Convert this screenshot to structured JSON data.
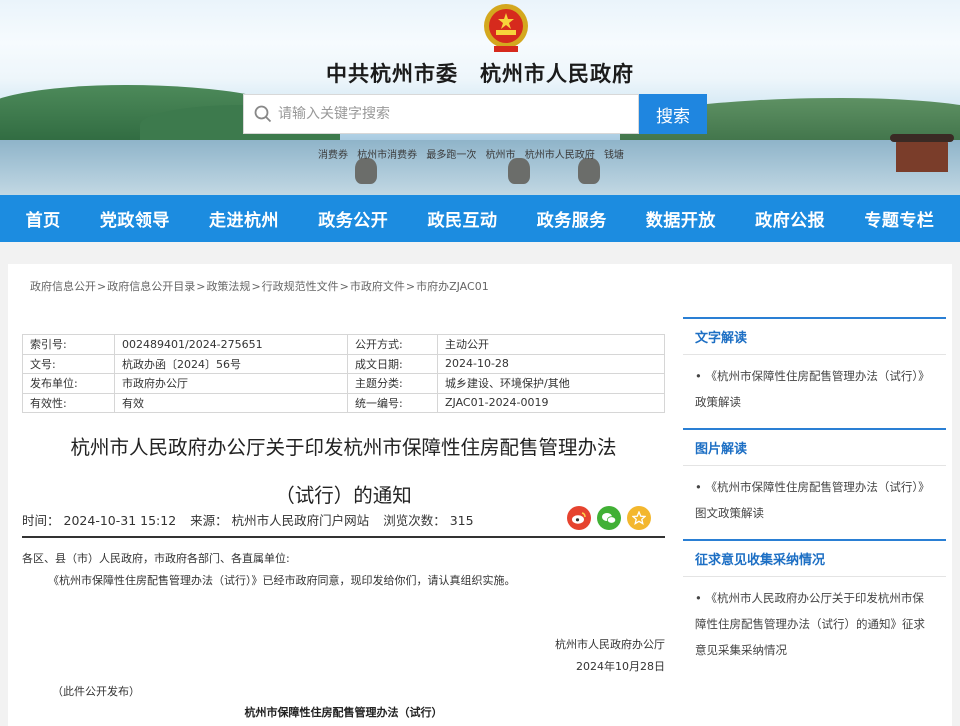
{
  "header": {
    "site_title": "中共杭州市委　杭州市人民政府",
    "search_placeholder": "请输入关键字搜索",
    "search_button": "搜索",
    "hot_words": [
      "消费券",
      "杭州市消费券",
      "最多跑一次",
      "杭州市",
      "杭州市人民政府",
      "钱塘"
    ]
  },
  "nav": [
    "首页",
    "党政领导",
    "走进杭州",
    "政务公开",
    "政民互动",
    "政务服务",
    "数据开放",
    "政府公报",
    "专题专栏"
  ],
  "breadcrumb": [
    "政府信息公开",
    "政府信息公开目录",
    "政策法规",
    "行政规范性文件",
    "市政府文件",
    "市府办ZJAC01"
  ],
  "meta": {
    "rows": [
      {
        "k1": "索引号:",
        "v1": "002489401/2024-275651",
        "k2": "公开方式:",
        "v2": "主动公开"
      },
      {
        "k1": "文号:",
        "v1": "杭政办函〔2024〕56号",
        "k2": "成文日期:",
        "v2": "2024-10-28"
      },
      {
        "k1": "发布单位:",
        "v1": "市政府办公厅",
        "k2": "主题分类:",
        "v2": "城乡建设、环境保护/其他"
      },
      {
        "k1": "有效性:",
        "v1": "有效",
        "k2": "统一编号:",
        "v2": "ZJAC01-2024-0019"
      }
    ]
  },
  "article": {
    "title_line1": "杭州市人民政府办公厅关于印发杭州市保障性住房配售管理办法",
    "title_line2": "（试行）的通知",
    "time_label": "时间：",
    "time": "2024-10-31 15:12",
    "source_label": "来源：",
    "source": "杭州市人民政府门户网站",
    "views_label": "浏览次数：",
    "views": "315",
    "salutation": "各区、县（市）人民政府，市政府各部门、各直属单位:",
    "paragraph": "《杭州市保障性住房配售管理办法（试行）》已经市政府同意，现印发给你们，请认真组织实施。",
    "signer": "杭州市人民政府办公厅",
    "sign_date": "2024年10月28日",
    "publish_note": "（此件公开发布）",
    "attachment_title": "杭州市保障性住房配售管理办法（试行）"
  },
  "sidebar": [
    {
      "title": "文字解读",
      "item": "• 《杭州市保障性住房配售管理办法（试行）》政策解读"
    },
    {
      "title": "图片解读",
      "item": "• 《杭州市保障性住房配售管理办法（试行）》图文政策解读"
    },
    {
      "title": "征求意见收集采纳情况",
      "item": "• 《杭州市人民政府办公厅关于印发杭州市保障性住房配售管理办法（试行）的通知》征求意见采集采纳情况"
    }
  ],
  "colors": {
    "nav_bg": "#1c8ce0",
    "search_btn": "#1f86e0",
    "side_head": "#1d6fc4"
  }
}
